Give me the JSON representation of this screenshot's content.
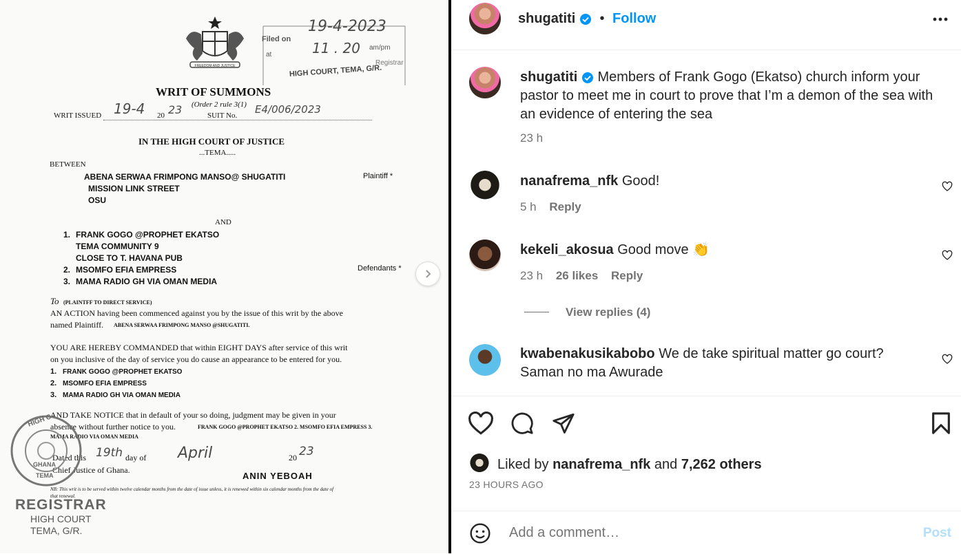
{
  "document": {
    "filed_label": "Filed on",
    "filed_date": "19-4-2023",
    "at_label": "at",
    "filed_time": "11 . 20",
    "ampm": "am/pm",
    "registrar_small": "Registrar",
    "stamp_court": "HIGH COURT, TEMA, G/R.",
    "title": "WRIT OF SUMMONS",
    "order": "(Order 2 rule 3(1)",
    "writ_issued_label": "WRIT ISSUED",
    "writ_issued_date": "19-4",
    "writ_year_prefix": "20",
    "writ_year_hand": "23",
    "suit_label": "SUIT No.",
    "suit_no_hand": "E4/006/2023",
    "court": "IN THE HIGH COURT OF JUSTICE",
    "court_place": "...TEMA.....",
    "between": "BETWEEN",
    "plaintiff_name": "ABENA SERWAA FRIMPONG MANSO@ SHUGATITI",
    "plaintiff_label": "Plaintiff *",
    "plaintiff_addr1": "MISSION LINK STREET",
    "plaintiff_addr2": "OSU",
    "and": "AND",
    "def1_num": "1.",
    "def1": "FRANK GOGO @PROPHET EKATSO",
    "def1_addr1": "TEMA COMMUNITY 9",
    "def1_addr2": "CLOSE TO T. HAVANA PUB",
    "def2_num": "2.",
    "def2": "MSOMFO EFIA EMPRESS",
    "def3_num": "3.",
    "def3": "MAMA RADIO GH VIA OMAN MEDIA",
    "defendants_label": "Defendants *",
    "to_label": "To",
    "to_note": "(PLAINTFF TO DIRECT SERVICE)",
    "para1_line1": "AN ACTION having been commenced against you by the issue of this writ by the above",
    "para1_line2a": "named Plaintiff.",
    "para1_line2b": "ABENA SERWAA FRIMPONG MANSO @SHUGATITI.",
    "para2_line1": "YOU ARE HEREBY COMMANDED that within EIGHT DAYS after service of this writ",
    "para2_line2": "on you inclusive of the day of service you do cause an appearance to be entered for you.",
    "list1_num": "1.",
    "list1": "FRANK GOGO @PROPHET EKATSO",
    "list2_num": "2.",
    "list2": "MSOMFO EFIA EMPRESS",
    "list3_num": "3.",
    "list3": "MAMA RADIO GH VIA OMAN MEDIA",
    "para3_line1": "AND TAKE NOTICE that in default of your so doing, judgment may be given in your",
    "para3_line2a": "absence without further notice to you.",
    "para3_line2b": "FRANK GOGO @PROPHET EKATSO 2. MSOMFO EFIA EMPRESS 3.",
    "para3_line3": "MAMA RADIO VIA OMAN MEDIA",
    "dated_label": "Dated this",
    "dated_day": "19th",
    "day_of": "day of",
    "dated_month": "April",
    "dated_year_prefix": "20",
    "dated_year_hand": "23",
    "chief_justice": "Chief Justice of Ghana.",
    "signature": "ANIN YEBOAH",
    "nb_note": "NB: This writ is to be served within twelve calendar months from the date of issue unless, it is renewed within six calendar months from the date of",
    "nb_note2": "that renewal.",
    "seal_top": "HIGH C",
    "seal_bottom": "GHANA",
    "seal_center": "TEMA",
    "registrar": "REGISTRAR",
    "reg_court": "HIGH COURT",
    "reg_place": "TEMA, G/R."
  },
  "post": {
    "username": "shugatiti",
    "dot": "•",
    "follow": "Follow",
    "caption": "Members of Frank Gogo (Ekatso) church inform your pastor to meet me in court to prove that I’m a demon of the sea with an evidence of entering the sea",
    "caption_time": "23 h"
  },
  "comments": [
    {
      "username": "nanafrema_nfk",
      "text": "Good!",
      "time": "5 h",
      "likes": "",
      "reply": "Reply"
    },
    {
      "username": "kekeli_akosua",
      "text": "Good move 👏",
      "time": "23 h",
      "likes": "26 likes",
      "reply": "Reply"
    },
    {
      "username": "kwabenakusikabobo",
      "text": "We de take spiritual matter go court? Saman no ma Awurade",
      "time": "",
      "likes": "",
      "reply": ""
    }
  ],
  "view_replies": "View replies (4)",
  "likes": {
    "liked_by": "Liked by",
    "liker": "nanafrema_nfk",
    "and": "and",
    "others": "7,262 others",
    "timestamp": "23 HOURS AGO"
  },
  "comment_box": {
    "placeholder": "Add a comment…",
    "post": "Post"
  },
  "colors": {
    "accent": "#0095f6",
    "post_disabled": "#b2dffc",
    "text": "#262626",
    "muted": "#737373"
  },
  "icons": [
    "more-options-icon",
    "verified-icon",
    "heart-icon",
    "comment-icon",
    "share-icon",
    "bookmark-icon",
    "emoji-icon",
    "chevron-right-icon"
  ]
}
